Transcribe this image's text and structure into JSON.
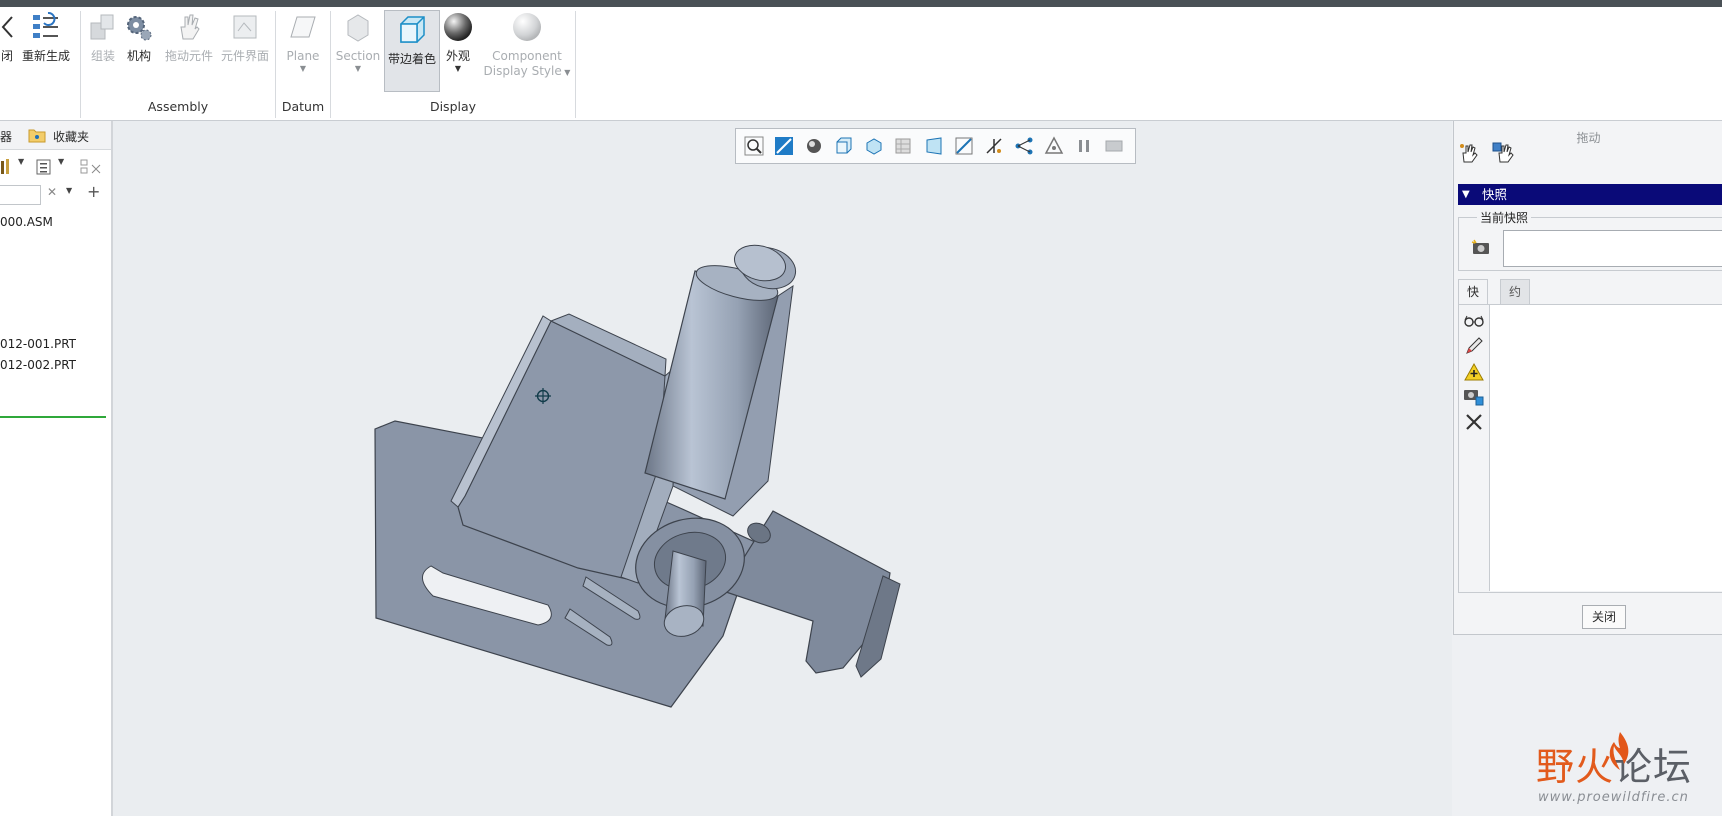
{
  "ribbon": {
    "left_cut_label": "闭",
    "regen_label": "重新生成",
    "assemble_label": "组装",
    "mechanism_label": "机构",
    "drag_components_label": "拖动元件",
    "component_interface_label": "元件界面",
    "plane_label": "Plane",
    "section_label": "Section",
    "shaded_edges_label": "带边着色",
    "appearance_label": "外观",
    "component_display_style_label_1": "Component",
    "component_display_style_label_2": "Display Style",
    "group_assembly": "Assembly",
    "group_datum": "Datum",
    "group_display": "Display"
  },
  "left_panel": {
    "tab_tree_partial": "器",
    "tab_favorites": "收藏夹",
    "items": [
      "000.ASM",
      "012-001.PRT",
      "012-002.PRT"
    ]
  },
  "drag_dialog": {
    "title": "拖动",
    "snapshots_header": "快照",
    "current_snapshot_legend": "当前快照",
    "current_snapshot_value": "",
    "tab_snapshots": "快照",
    "tab_constraints": "约束",
    "close_label": "关闭"
  },
  "watermark": {
    "cn_part1": "野火",
    "cn_part2": "论坛",
    "url": "www.proewildfire.cn"
  },
  "colors": {
    "accent": "#0a0a78",
    "model": "#8b97a8",
    "active_indicator": "#2fa83a"
  }
}
